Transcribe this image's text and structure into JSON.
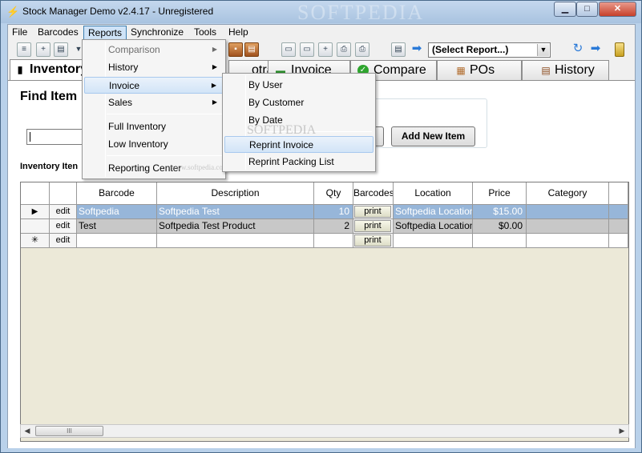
{
  "window": {
    "title": "Stock Manager Demo v2.4.17 - Unregistered",
    "watermark": "SOFTPEDIA",
    "minimize": "▁",
    "maximize": "□",
    "close": "✕"
  },
  "menubar": [
    "File",
    "Barcodes",
    "Reports",
    "Synchronize",
    "Tools",
    "Help"
  ],
  "toolbar": {
    "report_select": "(Select Report...)"
  },
  "tabs": [
    {
      "label": "Inventory",
      "icon": "barcode-icon"
    },
    {
      "label": "otract",
      "icon": "contract-icon"
    },
    {
      "label": "Invoice",
      "icon": "invoice-icon"
    },
    {
      "label": "Compare",
      "icon": "check-icon"
    },
    {
      "label": "POs",
      "icon": "po-icon"
    },
    {
      "label": "History",
      "icon": "history-icon"
    }
  ],
  "find": {
    "title": "Find Item",
    "add_new_item": "Add New Item"
  },
  "inventory_label": "Inventory Iten",
  "grid": {
    "headers": [
      "",
      "",
      "Barcode",
      "Description",
      "Qty",
      "Barcodes",
      "Location",
      "Price",
      "Category"
    ],
    "rows": [
      {
        "marker": "▶",
        "edit": "edit",
        "barcode": "Softpedia",
        "description": "Softpedia Test",
        "qty": "10",
        "print": "print",
        "location": "Softpedia Location",
        "price": "$15.00",
        "category": ""
      },
      {
        "marker": "",
        "edit": "edit",
        "barcode": "Test",
        "description": "Softpedia Test Product",
        "qty": "2",
        "print": "print",
        "location": "Softpedia Location",
        "price": "$0.00",
        "category": ""
      },
      {
        "marker": "✳",
        "edit": "edit",
        "barcode": "",
        "description": "",
        "qty": "",
        "print": "print",
        "location": "",
        "price": "",
        "category": ""
      }
    ],
    "hscroll_thumb": "III"
  },
  "reports_menu": {
    "items": [
      {
        "label": "Comparison",
        "disabled": true,
        "submenu": true
      },
      {
        "label": "History",
        "disabled": false,
        "submenu": true
      },
      {
        "label": "Invoice",
        "disabled": false,
        "submenu": true
      },
      {
        "label": "Sales",
        "disabled": false,
        "submenu": true
      },
      {
        "label": "Full Inventory",
        "disabled": false,
        "submenu": false
      },
      {
        "label": "Low Inventory",
        "disabled": false,
        "submenu": false
      },
      {
        "label": "Reporting Center",
        "disabled": false,
        "submenu": false
      }
    ]
  },
  "invoice_submenu": {
    "items": [
      "By User",
      "By Customer",
      "By Date",
      "Reprint Invoice",
      "Reprint Packing List"
    ]
  },
  "watermark_menu": "SOFTPEDIA",
  "watermark_url": "www.softpedia.com"
}
